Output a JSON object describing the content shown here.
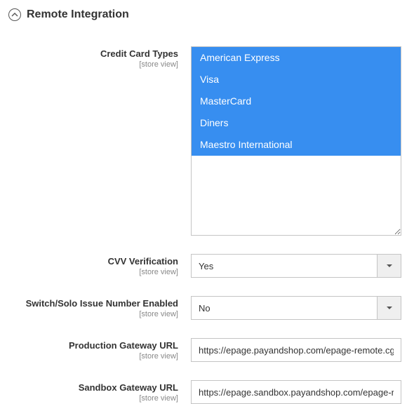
{
  "section": {
    "title": "Remote Integration",
    "expanded": true
  },
  "fields": {
    "credit_card_types": {
      "label": "Credit Card Types",
      "scope": "[store view]",
      "options": [
        {
          "label": "American Express",
          "selected": true
        },
        {
          "label": "Visa",
          "selected": true
        },
        {
          "label": "MasterCard",
          "selected": true
        },
        {
          "label": "Diners",
          "selected": true
        },
        {
          "label": "Maestro International",
          "selected": true
        }
      ]
    },
    "cvv_verification": {
      "label": "CVV Verification",
      "scope": "[store view]",
      "value": "Yes"
    },
    "switch_solo": {
      "label": "Switch/Solo Issue Number Enabled",
      "scope": "[store view]",
      "value": "No"
    },
    "production_url": {
      "label": "Production Gateway URL",
      "scope": "[store view]",
      "value": "https://epage.payandshop.com/epage-remote.cgi"
    },
    "sandbox_url": {
      "label": "Sandbox Gateway URL",
      "scope": "[store view]",
      "value": "https://epage.sandbox.payandshop.com/epage-remote.cgi"
    }
  }
}
